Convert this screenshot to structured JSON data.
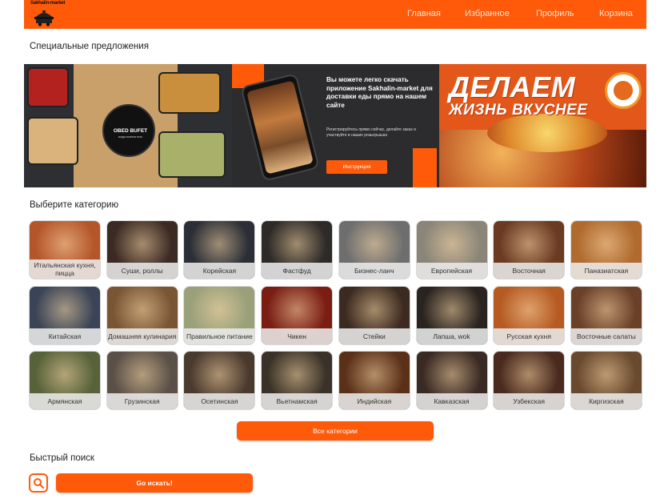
{
  "header": {
    "logo_text": "Sakhalin-market",
    "nav": [
      {
        "label": "Главная",
        "active": true
      },
      {
        "label": "Избранное",
        "active": false
      },
      {
        "label": "Профиль",
        "active": false
      },
      {
        "label": "Корзина",
        "active": false
      }
    ]
  },
  "offers": {
    "title": "Специальные предложения",
    "banner1": {
      "brand": "OBED BUFET",
      "tagline": "когда хочется есть"
    },
    "banner2": {
      "heading": "Вы можете легко скачать приложение Sakhalin-market для доставки еды прямо на нашем сайте",
      "text": "Регистрируйтесь прямо сейчас, делайте заказ и участвуйте в наших розыгрышах",
      "button": "Инструкция"
    },
    "banner3": {
      "line1": "ДЕЛАЕМ",
      "line2": "ЖИЗНЬ ВКУСНЕЕ"
    }
  },
  "categories": {
    "title": "Выберите категорию",
    "items": [
      {
        "label": "Итальянская кухня, пицца",
        "color": "#b5562a"
      },
      {
        "label": "Суши, роллы",
        "color": "#3b2a24"
      },
      {
        "label": "Корейская",
        "color": "#2b2e36"
      },
      {
        "label": "Фастфуд",
        "color": "#2d2a28"
      },
      {
        "label": "Бизнес-ланч",
        "color": "#6e6e6e"
      },
      {
        "label": "Европейская",
        "color": "#8a8578"
      },
      {
        "label": "Восточная",
        "color": "#6a3a22"
      },
      {
        "label": "Паназиатская",
        "color": "#b06a2e"
      },
      {
        "label": "Китайская",
        "color": "#3a4456"
      },
      {
        "label": "Домашняя кулинария",
        "color": "#7a5534"
      },
      {
        "label": "Правильное питание",
        "color": "#9aa07a"
      },
      {
        "label": "Чикен",
        "color": "#7a1e14"
      },
      {
        "label": "Стейки",
        "color": "#3b2a20"
      },
      {
        "label": "Лапша, wok",
        "color": "#2a2420"
      },
      {
        "label": "Русская кухня",
        "color": "#b65a22"
      },
      {
        "label": "Восточные салаты",
        "color": "#6a4028"
      },
      {
        "label": "Армянская",
        "color": "#58623a"
      },
      {
        "label": "Грузинская",
        "color": "#5a5048"
      },
      {
        "label": "Осетинская",
        "color": "#4a3a2e"
      },
      {
        "label": "Вьетнамская",
        "color": "#3a3228"
      },
      {
        "label": "Индийская",
        "color": "#5a3018"
      },
      {
        "label": "Кавказская",
        "color": "#3a2a24"
      },
      {
        "label": "Узбекская",
        "color": "#4a2a1e"
      },
      {
        "label": "Киргизская",
        "color": "#6a4a2e"
      }
    ],
    "all_button": "Все категории"
  },
  "quick_search": {
    "title": "Быстрый поиск",
    "go_button": "Go искать!",
    "search_icon": "search-icon"
  }
}
